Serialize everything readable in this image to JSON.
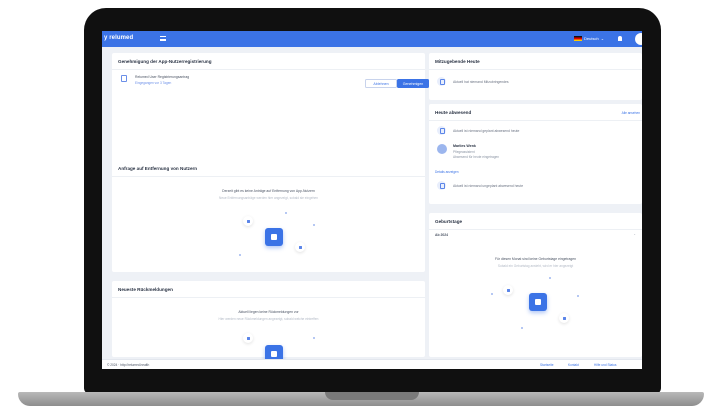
{
  "app": {
    "brand": "y relumed",
    "language": "Deutsch"
  },
  "approval": {
    "title": "Genehmigung der App-Nutzerregistrierung",
    "item_name": "Relumed User Registrierungsantrag",
    "item_sub": "Eingegangen vor 3 Tagen",
    "reject_label": "Ablehnen",
    "approve_label": "Genehmigen"
  },
  "removal": {
    "title": "Anfrage auf Entfernung von Nutzern",
    "empty_title": "Derzeit gibt es keine Anträge auf Entfernung von App-Nutzern",
    "empty_sub": "Neue Entfernungsanträge werden hier angezeigt, sobald sie eingehen"
  },
  "callbacks": {
    "title": "Neueste Rückmeldungen",
    "empty_title": "Aktuell liegen keine Rückmeldungen vor",
    "empty_sub": "Hier werden neue Rückmeldungen angezeigt, sobald welche eintreffen"
  },
  "pending": {
    "title": "Mitzugebende Heute",
    "item": "Aktuell hat niemand Mitzubringendes"
  },
  "today": {
    "title": "Heute abwesend",
    "action": "Alle ansehen",
    "row1": "Aktuell ist niemand geplant abwesend heute",
    "person_name": "Marlies Wenk",
    "person_role": "Pflegeassistent",
    "person_note": "Abwesend für heute eingetragen",
    "more": "Details anzeigen",
    "row2": "Aktuell ist niemand ungeplant abwesend heute"
  },
  "birthdays": {
    "title": "Geburtstage",
    "filter": "Ab 2024",
    "empty_title": "Für diesen Monat sind keine Geburtstage eingetragen",
    "empty_sub": "Sobald ein Geburtstag ansteht, wird er hier angezeigt"
  },
  "footer": {
    "copyright": "© 2024 · http://relumed.health",
    "links": [
      "Startseite",
      "Kontakt",
      "Hilfe und Status"
    ]
  }
}
